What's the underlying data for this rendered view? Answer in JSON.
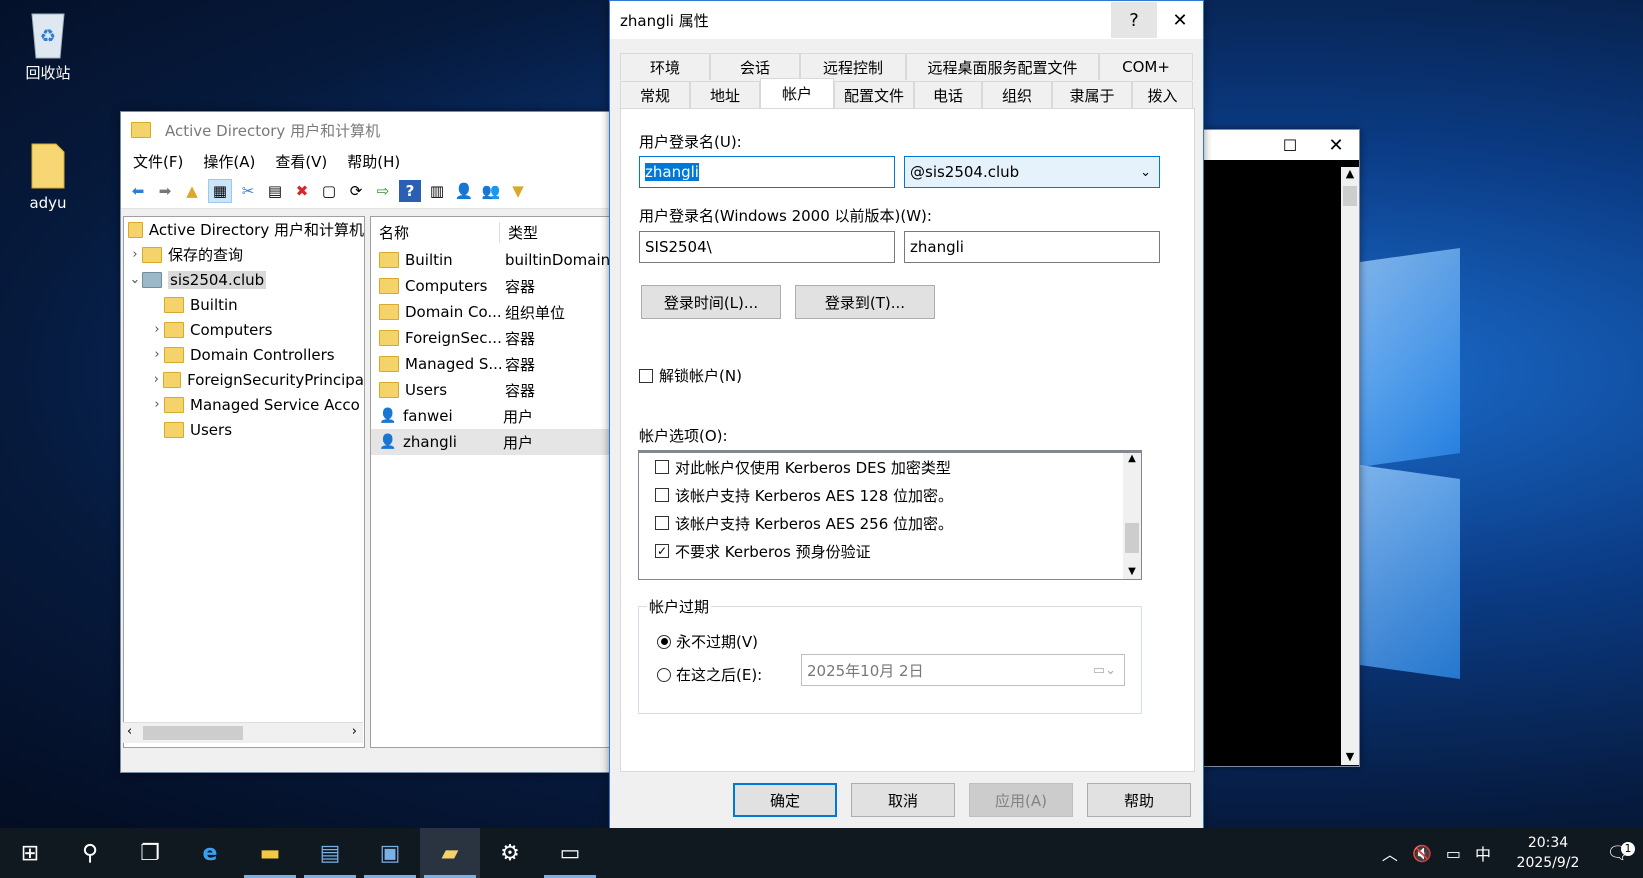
{
  "desktop": {
    "icons": [
      {
        "label": "回收站",
        "icon": "recycle-bin-icon"
      },
      {
        "label": "adyu",
        "icon": "folder-icon"
      }
    ]
  },
  "ad_window": {
    "title": "Active Directory 用户和计算机",
    "menu": [
      "文件(F)",
      "操作(A)",
      "查看(V)",
      "帮助(H)"
    ],
    "tree": {
      "root": "Active Directory 用户和计算机",
      "saved_queries": "保存的查询",
      "domain": "sis2504.club",
      "children": [
        "Builtin",
        "Computers",
        "Domain Controllers",
        "ForeignSecurityPrincipa",
        "Managed Service Acco",
        "Users"
      ]
    },
    "list": {
      "headers": {
        "name": "名称",
        "type": "类型"
      },
      "rows": [
        {
          "name": "Builtin",
          "type": "builtinDomain"
        },
        {
          "name": "Computers",
          "type": "容器"
        },
        {
          "name": "Domain Co...",
          "type": "组织单位"
        },
        {
          "name": "ForeignSec...",
          "type": "容器"
        },
        {
          "name": "Managed S...",
          "type": "容器"
        },
        {
          "name": "Users",
          "type": "容器"
        },
        {
          "name": "fanwei",
          "type": "用户"
        },
        {
          "name": "zhangli",
          "type": "用户"
        }
      ]
    }
  },
  "dialog": {
    "title": "zhangli 属性",
    "help_button": "?",
    "close_button": "✕",
    "tabs_row1": [
      "环境",
      "会话",
      "远程控制",
      "远程桌面服务配置文件",
      "COM+"
    ],
    "tabs_row2": [
      "常规",
      "地址",
      "帐户",
      "配置文件",
      "电话",
      "组织",
      "隶属于",
      "拨入"
    ],
    "active_tab": "帐户",
    "logon_name_label": "用户登录名(U):",
    "logon_name": "zhangli",
    "upn_suffix": "@sis2504.club",
    "pre2000_label": "用户登录名(Windows 2000 以前版本)(W):",
    "pre2000_domain": "SIS2504\\",
    "pre2000_name": "zhangli",
    "logon_hours_button": "登录时间(L)...",
    "logon_to_button": "登录到(T)...",
    "unlock_label": "解锁帐户(N)",
    "options_label": "帐户选项(O):",
    "options": [
      {
        "label": "对此帐户仅使用 Kerberos DES 加密类型",
        "checked": false
      },
      {
        "label": "该帐户支持 Kerberos AES 128 位加密。",
        "checked": false
      },
      {
        "label": "该帐户支持 Kerberos AES 256 位加密。",
        "checked": false
      },
      {
        "label": "不要求 Kerberos 预身份验证",
        "checked": true
      }
    ],
    "expiry_group": "帐户过期",
    "never_expires": "永不过期(V)",
    "end_of": "在这之后(E):",
    "expiry_date": "2025年10月  2日",
    "ok": "确定",
    "cancel": "取消",
    "apply": "应用(A)",
    "help": "帮助"
  },
  "taskbar": {
    "time": "20:34",
    "date": "2025/9/2",
    "ime": "中",
    "notifications": "1"
  }
}
